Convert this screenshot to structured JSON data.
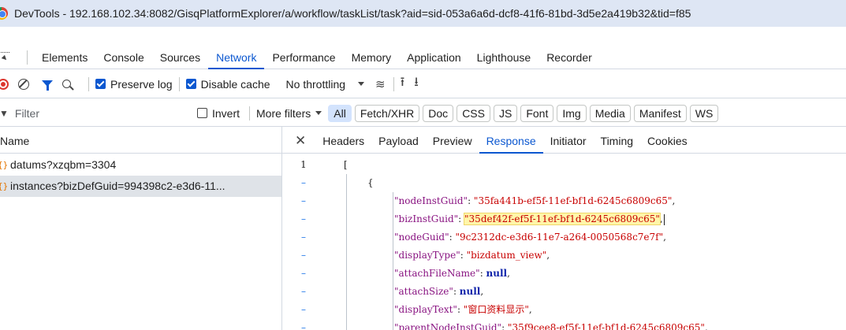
{
  "window": {
    "title": "DevTools - 192.168.102.34:8082/GisqPlatformExplorer/a/workflow/taskList/task?aid=sid-053a6a6d-dcf8-41f6-81bd-3d5e2a419b32&tid=f85"
  },
  "panel_tabs": [
    "Elements",
    "Console",
    "Sources",
    "Network",
    "Performance",
    "Memory",
    "Application",
    "Lighthouse",
    "Recorder"
  ],
  "active_panel": "Network",
  "toolbar": {
    "preserve_log": "Preserve log",
    "disable_cache": "Disable cache",
    "throttling": "No throttling"
  },
  "filterbar": {
    "placeholder": "Filter",
    "invert": "Invert",
    "more_filters": "More filters",
    "chips": [
      "All",
      "Fetch/XHR",
      "Doc",
      "CSS",
      "JS",
      "Font",
      "Img",
      "Media",
      "Manifest",
      "WS"
    ]
  },
  "requests": {
    "header": "Name",
    "rows": [
      {
        "name": "datums?xzqbm=3304"
      },
      {
        "name": "instances?bizDefGuid=994398c2-e3d6-11..."
      }
    ]
  },
  "detail": {
    "tabs": [
      "Headers",
      "Payload",
      "Preview",
      "Response",
      "Initiator",
      "Timing",
      "Cookies"
    ],
    "active": "Response"
  },
  "response": {
    "gutter": [
      "1",
      "–",
      "–",
      "–",
      "–",
      "–",
      "–",
      "–",
      "–",
      "–"
    ],
    "open_bracket": "[",
    "open_brace": "{",
    "fields": [
      {
        "key": "\"nodeInstGuid\"",
        "value": "\"35fa441b-ef5f-11ef-bf1d-6245c6809c65\"",
        "type": "string"
      },
      {
        "key": "\"bizInstGuid\"",
        "value": "\"35def42f-ef5f-11ef-bf1d-6245c6809c65\"",
        "type": "string"
      },
      {
        "key": "\"nodeGuid\"",
        "value": "\"9c2312dc-e3d6-11e7-a264-0050568c7e7f\"",
        "type": "string"
      },
      {
        "key": "\"displayType\"",
        "value": "\"bizdatum_view\"",
        "type": "string"
      },
      {
        "key": "\"attachFileName\"",
        "value": "null",
        "type": "null"
      },
      {
        "key": "\"attachSize\"",
        "value": "null",
        "type": "null"
      },
      {
        "key": "\"displayText\"",
        "value": "\"窗口资料显示\"",
        "type": "string"
      },
      {
        "key": "\"parentNodeInstGuid\"",
        "value": "\"35f9cee8-ef5f-11ef-bf1d-6245c6809c65\"",
        "type": "string"
      }
    ]
  },
  "colors": {
    "accent": "#0b57d0",
    "json_key": "#881280",
    "json_string": "#c80000",
    "highlight": "#fff6a9"
  }
}
